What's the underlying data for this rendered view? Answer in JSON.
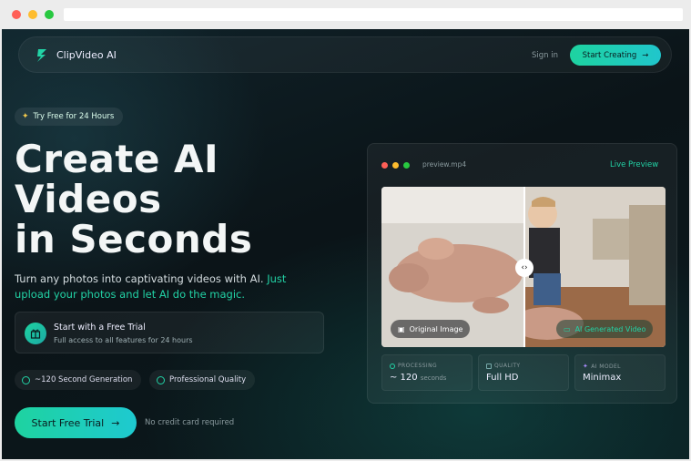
{
  "nav": {
    "brand": "ClipVideo AI",
    "sign_in": "Sign in",
    "start_creating": "Start Creating"
  },
  "hero": {
    "badge": "Try Free for 24 Hours",
    "headline_line1": "Create AI",
    "headline_line2": "Videos",
    "headline_line3": "in Seconds",
    "subtitle_plain": "Turn any photos into captivating videos with AI.",
    "subtitle_highlight": "Just upload your photos and let AI do the magic.",
    "trial_title": "Start with a Free Trial",
    "trial_desc": "Full access to all features for 24 hours",
    "features": [
      "~120 Second Generation",
      "Professional Quality"
    ],
    "cta": "Start Free Trial",
    "no_card": "No credit card required"
  },
  "preview": {
    "filename": "preview.mp4",
    "status": "Live Preview",
    "original_tag": "Original Image",
    "ai_tag": "AI Generated Video",
    "stats": [
      {
        "label": "PROCESSING",
        "value": "~ 120",
        "unit": "seconds"
      },
      {
        "label": "QUALITY",
        "value": "Full HD",
        "unit": ""
      },
      {
        "label": "AI MODEL",
        "value": "Minimax",
        "unit": ""
      }
    ]
  },
  "colors": {
    "accent": "#22d3a6",
    "background": "#0b1418"
  }
}
